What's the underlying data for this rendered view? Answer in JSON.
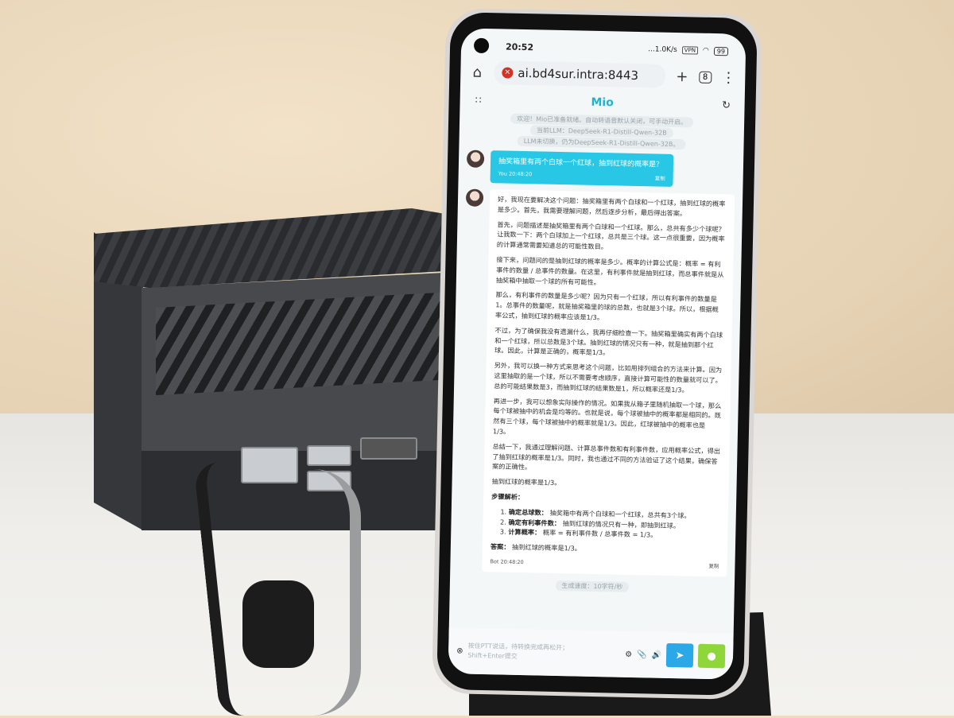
{
  "status": {
    "time": "20:52",
    "network_speed": "...1.0K/s",
    "vpn": "VPN",
    "battery": "99"
  },
  "browser": {
    "url": "ai.bd4sur.intra:8443",
    "tab_count": "8"
  },
  "app": {
    "title": "Mio"
  },
  "system_messages": [
    "欢迎！Mio已准备就绪。自动转语音默认关闭，可手动开启。",
    "当前LLM：DeepSeek-R1-Distill-Qwen-32B",
    "LLM未切换，仍为DeepSeek-R1-Distill-Qwen-32B。"
  ],
  "user_message": {
    "text": "抽奖箱里有两个白球一个红球，抽到红球的概率是？",
    "meta": "You 20:48:20",
    "copy": "复制"
  },
  "bot_message": {
    "paragraphs": [
      "好，我现在要解决这个问题：抽奖箱里有两个白球和一个红球，抽到红球的概率是多少。首先，我需要理解问题，然后逐步分析，最后得出答案。",
      "首先，问题描述是抽奖箱里有两个白球和一个红球。那么，总共有多少个球呢？让我数一下：两个白球加上一个红球，总共是三个球。这一点很重要，因为概率的计算通常需要知道总的可能性数目。",
      "接下来，问题问的是抽到红球的概率是多少。概率的计算公式是：概率 = 有利事件的数量 / 总事件的数量。在这里，有利事件就是抽到红球，而总事件就是从抽奖箱中抽取一个球的所有可能性。",
      "那么，有利事件的数量是多少呢？因为只有一个红球，所以有利事件的数量是1。总事件的数量呢，就是抽奖箱里的球的总数，也就是3个球。所以，根据概率公式，抽到红球的概率应该是1/3。",
      "不过，为了确保我没有遗漏什么，我再仔细检查一下。抽奖箱里确实有两个白球和一个红球，所以总数是3个球。抽到红球的情况只有一种，就是抽到那个红球。因此，计算是正确的，概率是1/3。",
      "另外，我可以换一种方式来思考这个问题，比如用排列组合的方法来计算。因为这里抽取的是一个球，所以不需要考虑顺序，直接计算可能性的数量就可以了。总的可能结果数是3，而抽到红球的结果数是1，所以概率还是1/3。",
      "再进一步，我可以想象实际操作的情况。如果我从箱子里随机抽取一个球，那么每个球被抽中的机会是均等的。也就是说，每个球被抽中的概率都是相同的。既然有三个球，每个球被抽中的概率就是1/3。因此，红球被抽中的概率也是1/3。",
      "总结一下，我通过理解问题、计算总事件数和有利事件数，应用概率公式，得出了抽到红球的概率是1/3。同时，我也通过不同的方法验证了这个结果，确保答案的正确性。",
      "抽到红球的概率是1/3。"
    ],
    "steps_title": "步骤解析：",
    "steps": [
      {
        "label": "确定总球数：",
        "text": "抽奖箱中有两个白球和一个红球，总共有3个球。"
      },
      {
        "label": "确定有利事件数：",
        "text": "抽到红球的情况只有一种，即抽到红球。"
      },
      {
        "label": "计算概率：",
        "text": "概率 = 有利事件数 / 总事件数 = 1/3。"
      }
    ],
    "answer_label": "答案：",
    "answer_text": "抽到红球的概率是1/3。",
    "meta": "Bot 20:48:20",
    "copy": "复制"
  },
  "generation_speed": "生成速度：10字符/秒",
  "input": {
    "placeholder": "按住PTT说话，待转换完成再松开；\nShift+Enter提交"
  },
  "icons": {
    "home": "home-icon",
    "insecure": "insecure-site-icon",
    "new_tab": "plus-icon",
    "menu": "more-vert-icon",
    "grid": "grid-menu-icon",
    "refresh": "refresh-icon",
    "settings": "gear-icon",
    "attach": "paperclip-icon",
    "speaker": "speaker-icon",
    "send": "send-icon",
    "mic": "microphone-icon"
  }
}
